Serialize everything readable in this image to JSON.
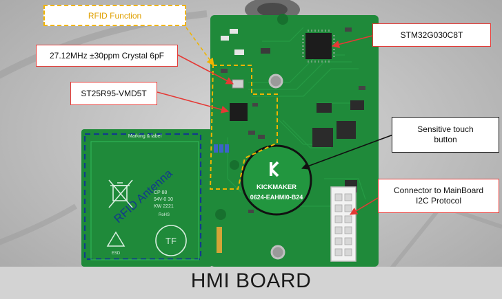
{
  "title": "HMI BOARD",
  "callouts": {
    "rfid_function": "RFID Function",
    "crystal": "27.12MHz ±30ppm Crystal 6pF",
    "rfid_chip": "ST25R95-VMD5T",
    "mcu": "STM32G030C8T",
    "touch_button": "Sensitive touch button",
    "connector": "Connector to MainBoard I2C Protocol"
  },
  "board": {
    "logo_brand": "KICKMAKER",
    "board_id": "0624-EAHMI0-B24",
    "antenna_label": "RFID Antenna",
    "silk_header": "Marking & label",
    "silk_code_1": "CP 88",
    "silk_code_2": "94V-0 30",
    "silk_code_3": "KW 2221",
    "silk_rohs": "RoHS",
    "silk_esd": "ESD",
    "tf_mark": "TF"
  },
  "colors": {
    "pcb": "#1f8a3a",
    "pcb_dark": "#17702e",
    "callout_border": "#e53935",
    "rfid_dash": "#f0b400",
    "antenna_dash": "#123a8c"
  }
}
